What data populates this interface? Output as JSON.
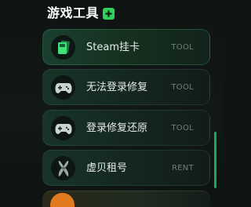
{
  "header": {
    "title": "游戏工具",
    "plus_icon": "plus-icon"
  },
  "items": [
    {
      "label": "Steam挂卡",
      "tag": "TOOL",
      "icon": "steam-card-icon",
      "active": true
    },
    {
      "label": "无法登录修复",
      "tag": "TOOL",
      "icon": "gamepad-icon",
      "active": false
    },
    {
      "label": "登录修复还原",
      "tag": "TOOL",
      "icon": "gamepad-icon",
      "active": false
    },
    {
      "label": "虚贝租号",
      "tag": "RENT",
      "icon": "rent-logo-icon",
      "active": false
    }
  ],
  "colors": {
    "accent": "#2fd05b",
    "scrollbar": "#22a35a",
    "tag_text": "#6f7f79"
  }
}
